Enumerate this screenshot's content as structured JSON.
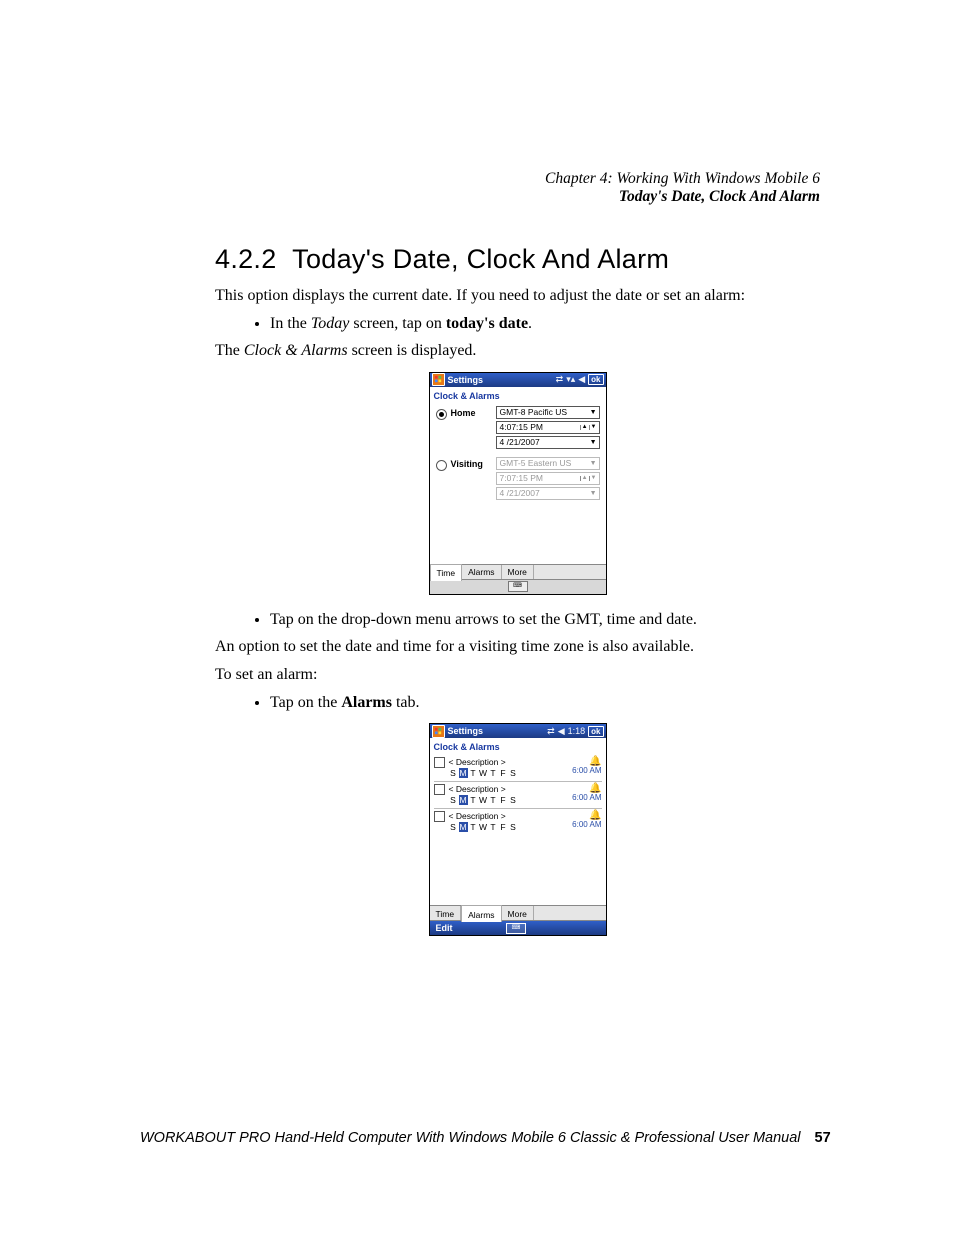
{
  "header": {
    "chapter": "Chapter 4: Working With Windows Mobile 6",
    "section_crumb": "Today's Date, Clock And Alarm"
  },
  "section": {
    "number": "4.2.2",
    "title": "Today's Date, Clock And Alarm"
  },
  "paragraphs": {
    "intro": "This option displays the current date. If you need to adjust the date or set an alarm:",
    "bullet1_prefix": "In the ",
    "bullet1_italic": "Today",
    "bullet1_mid": " screen, tap on ",
    "bullet1_bold": "today's date",
    "bullet1_suffix": ".",
    "after1_prefix": "The ",
    "after1_italic": "Clock & Alarms",
    "after1_suffix": " screen is displayed.",
    "bullet2": "Tap on the drop-down menu arrows to set the GMT, time and date.",
    "after2": "An option to set the date and time for a visiting time zone is also available.",
    "after3": "To set an alarm:",
    "bullet3_prefix": "Tap on the ",
    "bullet3_bold": "Alarms",
    "bullet3_suffix": " tab."
  },
  "screens": {
    "time": {
      "titlebar": "Settings",
      "tray_ok": "ok",
      "subheader": "Clock & Alarms",
      "home": {
        "label": "Home",
        "tz": "GMT-8 Pacific US",
        "time": "4:07:15 PM",
        "date": "4 /21/2007"
      },
      "visiting": {
        "label": "Visiting",
        "tz": "GMT-5 Eastern US",
        "time": "7:07:15 PM",
        "date": "4 /21/2007"
      },
      "tabs": {
        "time": "Time",
        "alarms": "Alarms",
        "more": "More"
      }
    },
    "alarms": {
      "titlebar": "Settings",
      "tray_time": "1:18",
      "tray_ok": "ok",
      "subheader": "Clock & Alarms",
      "row": {
        "description": "< Description >",
        "days": [
          "S",
          "M",
          "T",
          "W",
          "T",
          "F",
          "S"
        ],
        "selected_day_index": 1,
        "time": "6:00 AM"
      },
      "tabs": {
        "time": "Time",
        "alarms": "Alarms",
        "more": "More"
      },
      "edit_label": "Edit"
    }
  },
  "footer": {
    "text": "WORKABOUT PRO Hand-Held Computer With Windows Mobile 6 Classic & Professional User Manual",
    "page": "57"
  }
}
